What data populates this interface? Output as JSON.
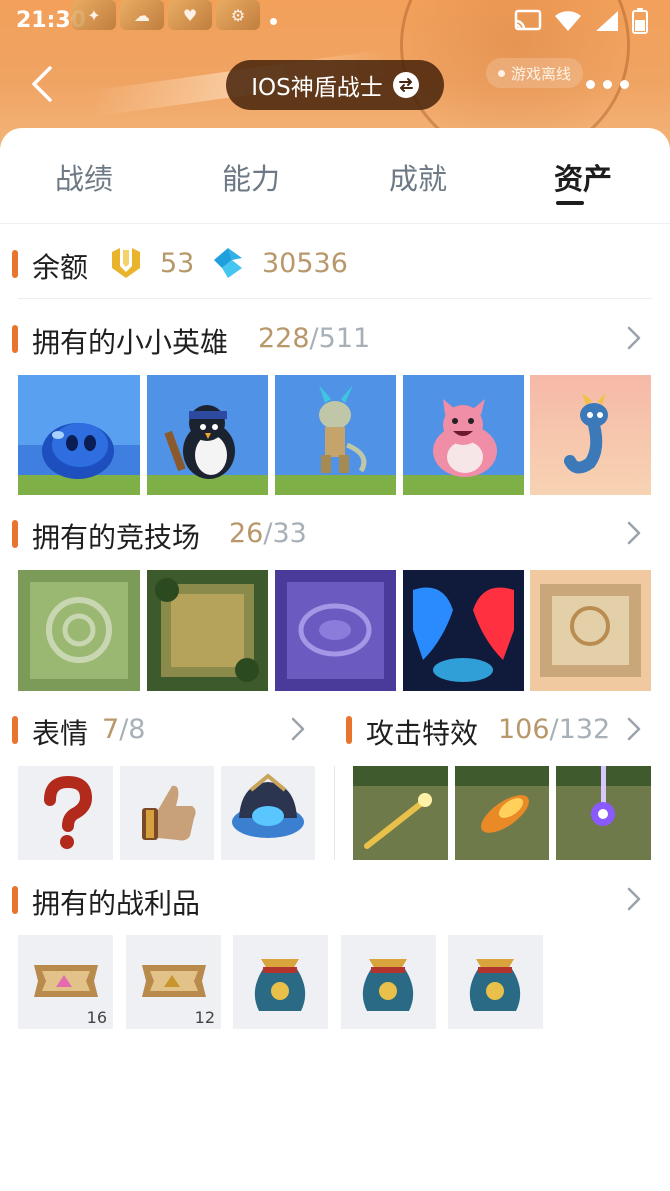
{
  "status_bar": {
    "time": "21:30"
  },
  "header": {
    "player_name": "IOS神盾战士",
    "status": "游戏离线"
  },
  "tabs": [
    {
      "label": "战绩",
      "active": false
    },
    {
      "label": "能力",
      "active": false
    },
    {
      "label": "成就",
      "active": false
    },
    {
      "label": "资产",
      "active": true
    }
  ],
  "balance": {
    "label": "余额",
    "coins": "53",
    "gems": "30536"
  },
  "little_legends": {
    "title": "拥有的小小英雄",
    "owned": "228",
    "total": "/511",
    "items": [
      {
        "icon": "blue-blob-legend"
      },
      {
        "icon": "penguin-legend"
      },
      {
        "icon": "dragon-warrior-legend"
      },
      {
        "icon": "pink-cat-legend"
      },
      {
        "icon": "blue-dragon-legend"
      }
    ]
  },
  "arenas": {
    "title": "拥有的竞技场",
    "owned": "26",
    "total": "/33",
    "items": [
      {
        "icon": "green-swirl-arena"
      },
      {
        "icon": "jungle-arena"
      },
      {
        "icon": "purple-arena"
      },
      {
        "icon": "ice-fire-dragon-arena"
      },
      {
        "icon": "golden-arena"
      }
    ]
  },
  "emotes": {
    "title": "表情",
    "owned": "7",
    "total": "/8",
    "items": [
      {
        "icon": "question-mark-emote"
      },
      {
        "icon": "thumbs-up-emote"
      },
      {
        "icon": "blue-helmet-emote"
      }
    ]
  },
  "attack_effects": {
    "title": "攻击特效",
    "owned": "106",
    "total": "/132",
    "items": [
      {
        "icon": "golden-bolt-effect"
      },
      {
        "icon": "fire-bolt-effect"
      },
      {
        "icon": "purple-beam-effect"
      }
    ]
  },
  "loot": {
    "title": "拥有的战利品",
    "items": [
      {
        "icon": "pink-ticket-loot",
        "count": "16"
      },
      {
        "icon": "gold-ticket-loot",
        "count": "12"
      },
      {
        "icon": "treasure-bag-loot",
        "count": ""
      },
      {
        "icon": "treasure-bag-loot",
        "count": ""
      },
      {
        "icon": "treasure-bag-loot",
        "count": ""
      }
    ]
  },
  "colors": {
    "accent": "#e8742e",
    "count_text": "#b8986a",
    "header_bg": "#f2a05a"
  }
}
